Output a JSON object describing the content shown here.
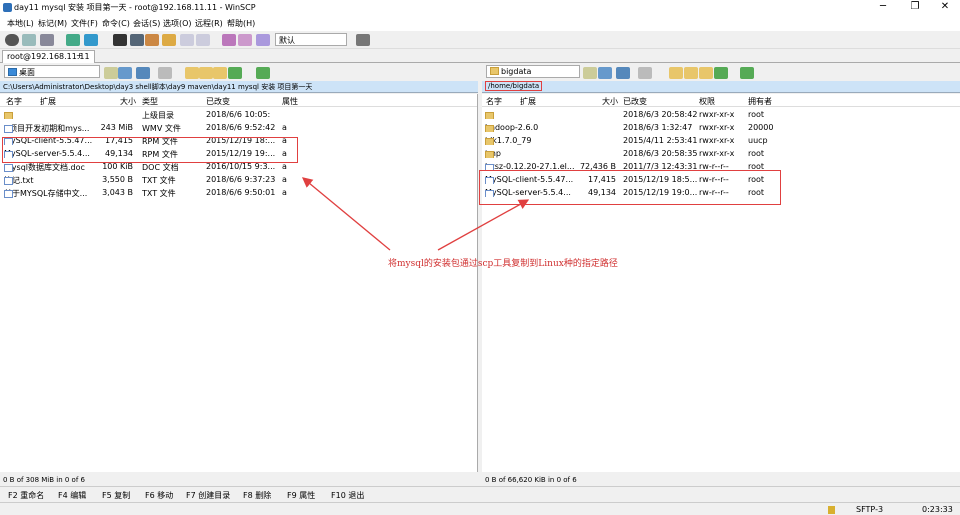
{
  "window": {
    "title": "day11 mysql 安装  项目第一天 - root@192.168.11.11 - WinSCP",
    "minimize": "─",
    "maximize": "❐",
    "close": "✕"
  },
  "menu": [
    "本地(L)",
    "标记(M)",
    "文件(F)",
    "命令(C)",
    "会话(S)",
    "选项(O)",
    "远程(R)",
    "帮助(H)"
  ],
  "toolbar": {
    "transfer_setting": "默认"
  },
  "session_tab": {
    "label": "root@192.168.11.11",
    "add": "+"
  },
  "left": {
    "location": "桌面",
    "path": "C:\\Users\\Administrator\\Desktop\\day3 shell脚本\\day9 maven\\day11 mysql 安装  项目第一天",
    "headers": {
      "name": "名字",
      "ext": "扩展",
      "size": "大小",
      "type": "类型",
      "changed": "已改变",
      "attr": "属性"
    },
    "rows": [
      {
        "name": "..",
        "size": "",
        "type": "上级目录",
        "changed": "2018/6/6  10:05:",
        "attr": "",
        "kind": "up"
      },
      {
        "name": "1项目开发初期和mys...",
        "size": "243 MiB",
        "type": "WMV 文件",
        "changed": "2018/6/6  9:52:42",
        "attr": "a",
        "kind": "file"
      },
      {
        "name": "MySQL-client-5.5.47...",
        "size": "17,415",
        "type": "RPM 文件",
        "changed": "2015/12/19  18:...",
        "attr": "a",
        "kind": "file"
      },
      {
        "name": "MySQL-server-5.5.4...",
        "size": "49,134",
        "type": "RPM 文件",
        "changed": "2015/12/19  19:...",
        "attr": "a",
        "kind": "file"
      },
      {
        "name": "mysql数据库文档.doc",
        "size": "100 KiB",
        "type": "DOC 文档",
        "changed": "2016/10/15  9:3...",
        "attr": "a",
        "kind": "file"
      },
      {
        "name": "笔记.txt",
        "size": "3,550 B",
        "type": "TXT 文件",
        "changed": "2018/6/6  9:37:23",
        "attr": "a",
        "kind": "file"
      },
      {
        "name": "关于MYSQL存储中文...",
        "size": "3,043 B",
        "type": "TXT 文件",
        "changed": "2018/6/6  9:50:01",
        "attr": "a",
        "kind": "file"
      }
    ],
    "status": "0 B of 308 MiB in 0 of 6"
  },
  "right": {
    "location": "bigdata",
    "path": "/home/bigdata",
    "headers": {
      "name": "名字",
      "ext": "扩展",
      "size": "大小",
      "changed": "已改变",
      "rights": "权限",
      "owner": "拥有者"
    },
    "rows": [
      {
        "name": "..",
        "size": "",
        "changed": "2018/6/3 20:58:42",
        "rights": "rwxr-xr-x",
        "owner": "root",
        "kind": "up"
      },
      {
        "name": "hadoop-2.6.0",
        "size": "",
        "changed": "2018/6/3 1:32:47",
        "rights": "rwxr-xr-x",
        "owner": "20000",
        "kind": "folder"
      },
      {
        "name": "jdk1.7.0_79",
        "size": "",
        "changed": "2015/4/11 2:53:41",
        "rights": "rwxr-xr-x",
        "owner": "uucp",
        "kind": "folder"
      },
      {
        "name": "tmp",
        "size": "",
        "changed": "2018/6/3 20:58:35",
        "rights": "rwxr-xr-x",
        "owner": "root",
        "kind": "folder"
      },
      {
        "name": "lrzsz-0.12.20-27.1.el...",
        "size": "72,436 B",
        "changed": "2011/7/3 12:43:31",
        "rights": "rw-r--r--",
        "owner": "root",
        "kind": "file"
      },
      {
        "name": "MySQL-client-5.5.47...",
        "size": "17,415",
        "changed": "2015/12/19 18:5...",
        "rights": "rw-r--r--",
        "owner": "root",
        "kind": "file"
      },
      {
        "name": "MySQL-server-5.5.4...",
        "size": "49,134",
        "changed": "2015/12/19 19:0...",
        "rights": "rw-r--r--",
        "owner": "root",
        "kind": "file"
      }
    ],
    "status": "0 B of 66,620 KiB in 0 of 6"
  },
  "fkeys": [
    "F2 重命名",
    "F4 编辑",
    "F5 复制",
    "F6 移动",
    "F7 创建目录",
    "F8 删除",
    "F9 属性",
    "F10 退出"
  ],
  "bottom": {
    "protocol": "SFTP-3",
    "time": "0:23:33"
  },
  "annotation": "将mysql的安装包通过scp工具复制到Linux种的指定路径",
  "colors": {
    "accent": "#cde3f7",
    "annotation": "#d03030"
  }
}
